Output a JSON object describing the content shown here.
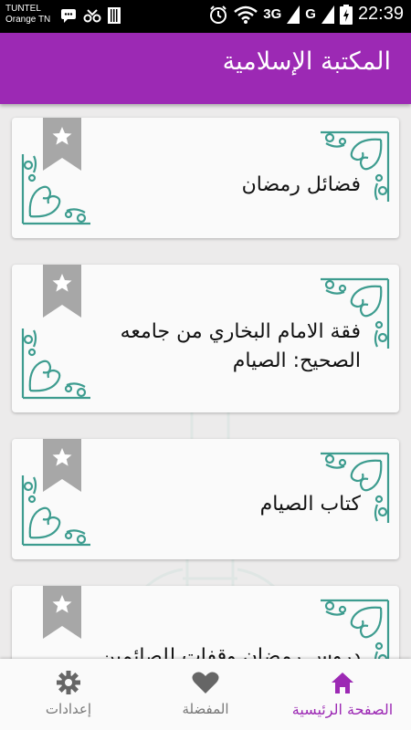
{
  "status_bar": {
    "carrier_line1": "TUNTEL",
    "carrier_line2": "Orange TN",
    "network1": "3G",
    "network2": "G",
    "time": "22:39"
  },
  "app_bar": {
    "title": "المكتبة الإسلامية"
  },
  "cards": [
    {
      "title": "فضائل رمضان"
    },
    {
      "title": "فقة الامام البخاري من جامعه الصحيح: الصيام"
    },
    {
      "title": "كتاب الصيام"
    },
    {
      "title": "دروس رمضان وقفات للصائمين"
    }
  ],
  "bottom_nav": {
    "items": [
      {
        "label": "الصفحة الرئيسية",
        "icon": "home-icon",
        "active": true
      },
      {
        "label": "المفضلة",
        "icon": "heart-icon",
        "active": false
      },
      {
        "label": "إعدادات",
        "icon": "gear-icon",
        "active": false
      }
    ]
  },
  "colors": {
    "primary": "#9c29b4",
    "ornament": "#3d9c8f",
    "ribbon": "#a7a7a7"
  }
}
